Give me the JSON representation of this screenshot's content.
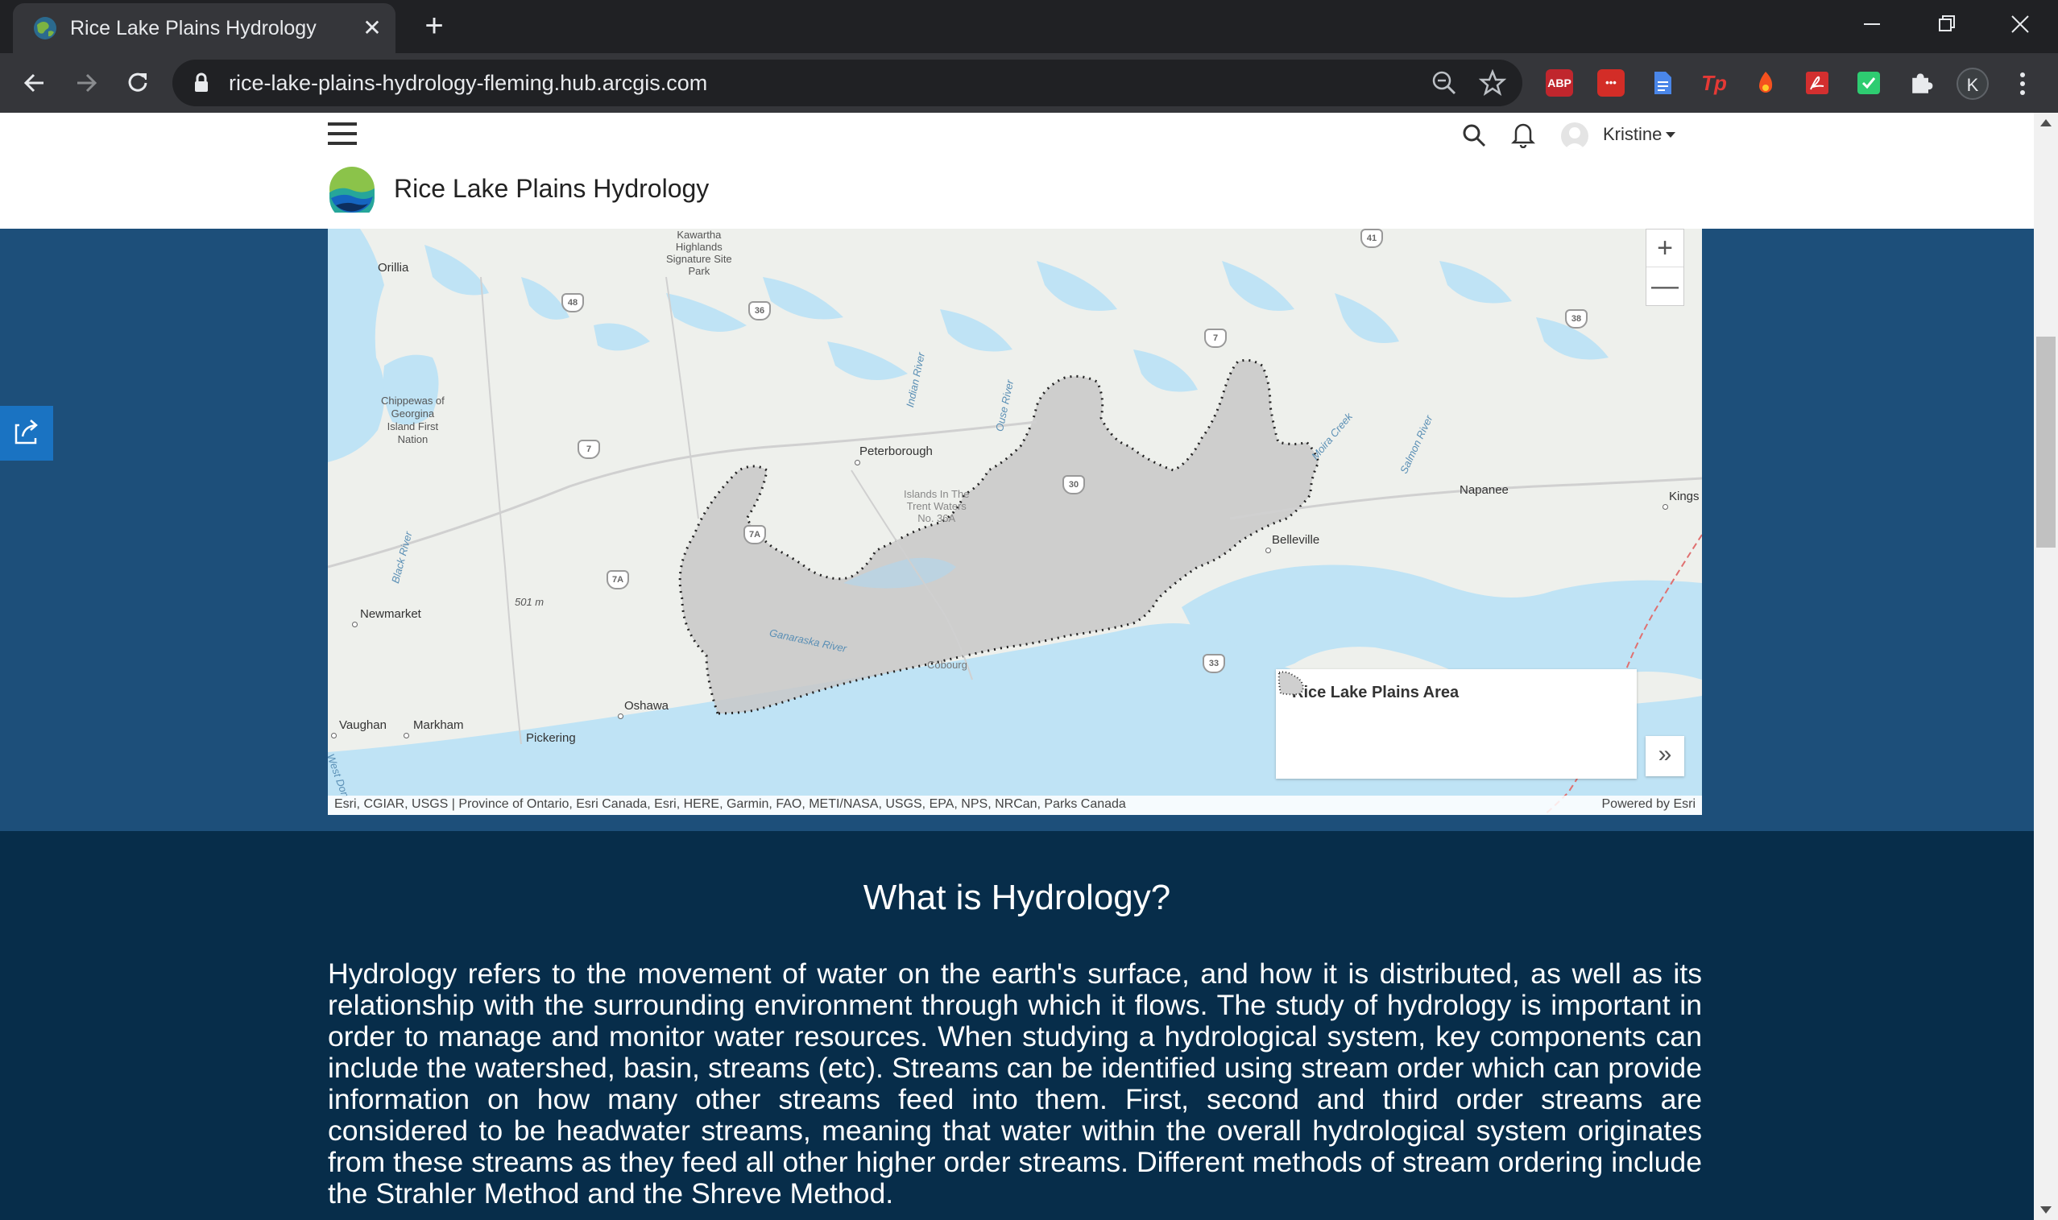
{
  "browser": {
    "tab_title": "Rice Lake Plains Hydrology",
    "url": "rice-lake-plains-hydrology-fleming.hub.arcgis.com",
    "profile_initial": "K",
    "extensions": [
      {
        "name": "abp",
        "label": "ABP",
        "color": "#c0262d"
      },
      {
        "name": "lastpass",
        "label": "•••",
        "color": "#d32d27"
      },
      {
        "name": "docs",
        "label": "",
        "color": "#4a86e8"
      },
      {
        "name": "tp",
        "label": "Tp",
        "color": "#e53935"
      },
      {
        "name": "fire",
        "label": "",
        "color": "#f4511e"
      },
      {
        "name": "pdf",
        "label": "",
        "color": "#d32f2f"
      },
      {
        "name": "grammar",
        "label": "",
        "color": "#2ecc71"
      }
    ]
  },
  "site": {
    "title": "Rice Lake Plains Hydrology",
    "user": "Kristine"
  },
  "map": {
    "labels": {
      "orillia": "Orillia",
      "kawartha": "Kawartha\nHighlands\nSignature Site\nPark",
      "chippewas": "Chippewas of\nGeorgina\nIsland First\nNation",
      "peterborough": "Peterborough",
      "islands": "Islands In The\nTrent Waters\nNo. 36A",
      "napanee": "Napanee",
      "kingston": "Kings",
      "belleville": "Belleville",
      "newmarket": "Newmarket",
      "elev": "501 m",
      "oshawa": "Oshawa",
      "cobourg": "Cobourg",
      "vaughan": "Vaughan",
      "markham": "Markham",
      "pickering": "Pickering",
      "indian_river": "Indian River",
      "otonabee": "Ouse River",
      "moira": "Moira Creek",
      "salmon": "Salmon River",
      "black_river": "Black River",
      "ganaraska": "Ganaraska River",
      "west_don": "West Don R."
    },
    "highways": {
      "h41": "41",
      "h48": "48",
      "h36": "36",
      "h38": "38",
      "h7a": "7",
      "h7b": "7",
      "h30": "30",
      "h7A1": "7A",
      "h7A2": "7A",
      "h33": "33"
    },
    "zoom_in": "+",
    "zoom_out": "—",
    "legend_title": "Rice Lake Plains Area",
    "legend_toggle": "»",
    "attribution": "Esri, CGIAR, USGS | Province of Ontario, Esri Canada, Esri, HERE, Garmin, FAO, METI/NASA, USGS, EPA, NPS, NRCan, Parks Canada",
    "powered_by": "Powered by Esri"
  },
  "hydrology": {
    "heading": "What is Hydrology?",
    "body": "Hydrology refers to the movement of water on the earth's surface, and how it is distributed, as well as its relationship with the surrounding environment through which it flows. The study of hydrology is important in order to manage and monitor water resources. When studying a hydrological system, key components can include the watershed, basin, streams (etc). Streams can be identified using stream order which can provide information on how many other streams feed into them. First, second and third order streams are considered to be headwater streams, meaning that water within the overall hydrological system originates from these streams as they feed all other higher order streams. Different methods of stream ordering include the Strahler Method and the Shreve Method."
  }
}
